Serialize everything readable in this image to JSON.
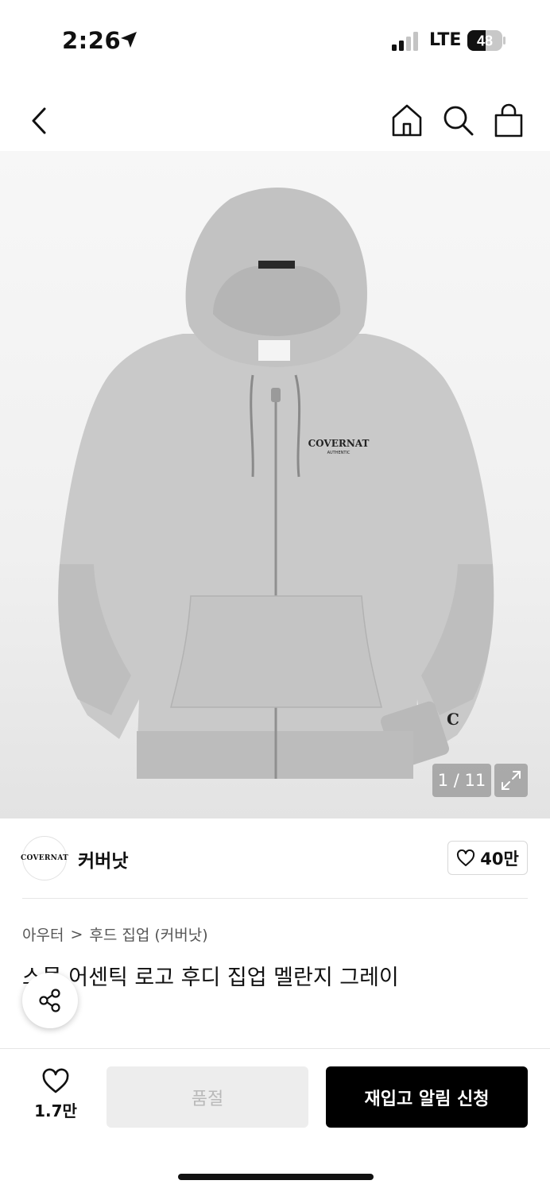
{
  "status_bar": {
    "time": "2:26",
    "network": "LTE",
    "battery": "48",
    "signal_bars_active": 2,
    "signal_bars_total": 4
  },
  "nav": {
    "back_icon": "chevron-left-icon",
    "home_icon": "home-icon",
    "search_icon": "search-icon",
    "bag_icon": "shopping-bag-icon"
  },
  "gallery": {
    "counter": "1 / 11",
    "logo_text": "COVERNAT",
    "logo_sub": "AUTHENTIC",
    "sleeve_mark": "C",
    "hoodie_color": "#c9c9c9"
  },
  "brand": {
    "logo_text": "COVERNAT",
    "name": "커버낫",
    "like_count": "40만"
  },
  "breadcrumb": {
    "level1": "아우터",
    "separator": ">",
    "level2": "후드 집업 (커버낫)"
  },
  "product": {
    "title": "스몰 어센틱 로고 후디 집업 멜란지 그레이"
  },
  "bottom": {
    "wish_count": "1.7만",
    "soldout_label": "품절",
    "restock_label": "재입고 알림 신청"
  },
  "colors": {
    "primary_button": "#000000",
    "disabled_button": "#ededed",
    "disabled_text": "#b9b9b9"
  }
}
